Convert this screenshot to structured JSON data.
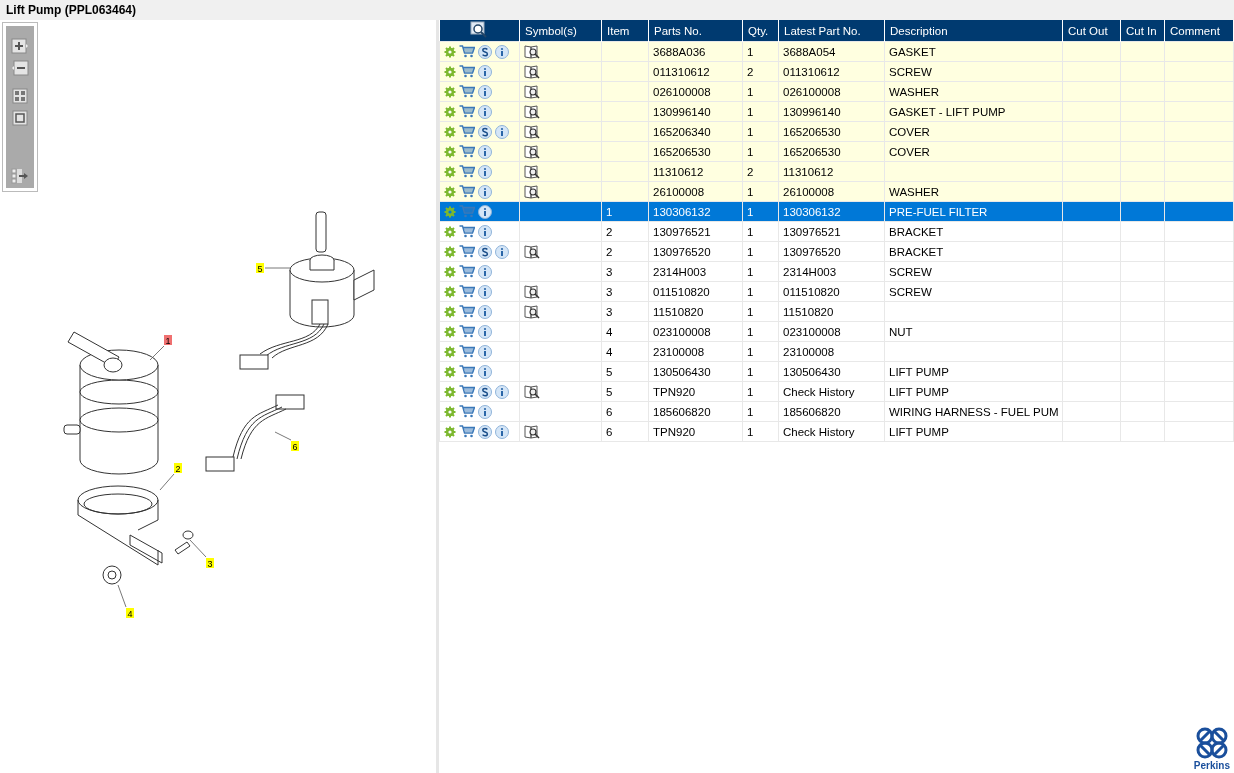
{
  "title": "Lift Pump (PPL063464)",
  "diagram": {
    "callouts": [
      {
        "label": "5",
        "highlighted": false
      },
      {
        "label": "1",
        "highlighted": true
      },
      {
        "label": "6",
        "highlighted": false
      },
      {
        "label": "2",
        "highlighted": false
      },
      {
        "label": "3",
        "highlighted": false
      },
      {
        "label": "4",
        "highlighted": false
      }
    ]
  },
  "table": {
    "columns": [
      "Symbol(s)",
      "Item",
      "Parts No.",
      "Qty.",
      "Latest Part No.",
      "Description",
      "Cut Out",
      "Cut In",
      "Comment"
    ],
    "rows": [
      {
        "highlighted": true,
        "selected": false,
        "supersession": true,
        "symbol": true,
        "item": "",
        "parts_no": "3688A036",
        "qty": "1",
        "latest": "3688A054",
        "description": "GASKET"
      },
      {
        "highlighted": true,
        "selected": false,
        "supersession": false,
        "symbol": true,
        "item": "",
        "parts_no": "011310612",
        "qty": "2",
        "latest": "011310612",
        "description": "SCREW"
      },
      {
        "highlighted": true,
        "selected": false,
        "supersession": false,
        "symbol": true,
        "item": "",
        "parts_no": "026100008",
        "qty": "1",
        "latest": "026100008",
        "description": "WASHER"
      },
      {
        "highlighted": true,
        "selected": false,
        "supersession": false,
        "symbol": true,
        "item": "",
        "parts_no": "130996140",
        "qty": "1",
        "latest": "130996140",
        "description": "GASKET - LIFT PUMP"
      },
      {
        "highlighted": true,
        "selected": false,
        "supersession": true,
        "symbol": true,
        "item": "",
        "parts_no": "165206340",
        "qty": "1",
        "latest": "165206530",
        "description": "COVER"
      },
      {
        "highlighted": true,
        "selected": false,
        "supersession": false,
        "symbol": true,
        "item": "",
        "parts_no": "165206530",
        "qty": "1",
        "latest": "165206530",
        "description": "COVER"
      },
      {
        "highlighted": true,
        "selected": false,
        "supersession": false,
        "symbol": true,
        "item": "",
        "parts_no": "11310612",
        "qty": "2",
        "latest": "11310612",
        "description": ""
      },
      {
        "highlighted": true,
        "selected": false,
        "supersession": false,
        "symbol": true,
        "item": "",
        "parts_no": "26100008",
        "qty": "1",
        "latest": "26100008",
        "description": "WASHER"
      },
      {
        "highlighted": false,
        "selected": true,
        "supersession": false,
        "symbol": false,
        "item": "1",
        "parts_no": "130306132",
        "qty": "1",
        "latest": "130306132",
        "description": "PRE-FUEL FILTER"
      },
      {
        "highlighted": false,
        "selected": false,
        "supersession": false,
        "symbol": false,
        "item": "2",
        "parts_no": "130976521",
        "qty": "1",
        "latest": "130976521",
        "description": "BRACKET"
      },
      {
        "highlighted": false,
        "selected": false,
        "supersession": true,
        "symbol": true,
        "item": "2",
        "parts_no": "130976520",
        "qty": "1",
        "latest": "130976520",
        "description": "BRACKET"
      },
      {
        "highlighted": false,
        "selected": false,
        "supersession": false,
        "symbol": false,
        "item": "3",
        "parts_no": "2314H003",
        "qty": "1",
        "latest": "2314H003",
        "description": "SCREW"
      },
      {
        "highlighted": false,
        "selected": false,
        "supersession": false,
        "symbol": true,
        "item": "3",
        "parts_no": "011510820",
        "qty": "1",
        "latest": "011510820",
        "description": "SCREW"
      },
      {
        "highlighted": false,
        "selected": false,
        "supersession": false,
        "symbol": true,
        "item": "3",
        "parts_no": "11510820",
        "qty": "1",
        "latest": "11510820",
        "description": ""
      },
      {
        "highlighted": false,
        "selected": false,
        "supersession": false,
        "symbol": false,
        "item": "4",
        "parts_no": "023100008",
        "qty": "1",
        "latest": "023100008",
        "description": "NUT"
      },
      {
        "highlighted": false,
        "selected": false,
        "supersession": false,
        "symbol": false,
        "item": "4",
        "parts_no": "23100008",
        "qty": "1",
        "latest": "23100008",
        "description": ""
      },
      {
        "highlighted": false,
        "selected": false,
        "supersession": false,
        "symbol": false,
        "item": "5",
        "parts_no": "130506430",
        "qty": "1",
        "latest": "130506430",
        "description": "LIFT PUMP"
      },
      {
        "highlighted": false,
        "selected": false,
        "supersession": true,
        "symbol": true,
        "item": "5",
        "parts_no": "TPN920",
        "qty": "1",
        "latest": "Check History",
        "description": "LIFT PUMP"
      },
      {
        "highlighted": false,
        "selected": false,
        "supersession": false,
        "symbol": false,
        "item": "6",
        "parts_no": "185606820",
        "qty": "1",
        "latest": "185606820",
        "description": "WIRING HARNESS - FUEL PUM"
      },
      {
        "highlighted": false,
        "selected": false,
        "supersession": true,
        "symbol": true,
        "item": "6",
        "parts_no": "TPN920",
        "qty": "1",
        "latest": "Check History",
        "description": "LIFT PUMP"
      }
    ]
  },
  "logo": {
    "text": "Perkins"
  }
}
